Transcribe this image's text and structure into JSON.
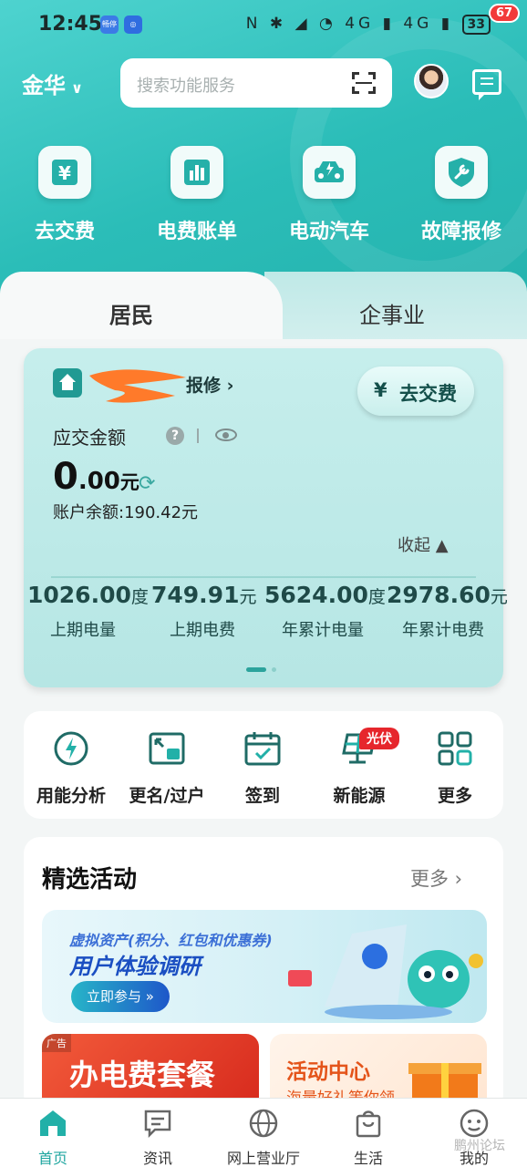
{
  "status_bar": {
    "time": "12:45",
    "app_badge_1": "畅停",
    "icons": "N ✱ ◢ ◔ 4G ▮ 4G ▮",
    "battery": "33"
  },
  "header": {
    "city": "金华",
    "search_placeholder": "搜索功能服务",
    "message_count": "67"
  },
  "quick_actions": [
    {
      "label": "去交费",
      "icon": "yuan-icon"
    },
    {
      "label": "电费账单",
      "icon": "bar-chart-icon"
    },
    {
      "label": "电动汽车",
      "icon": "ev-car-icon"
    },
    {
      "label": "故障报修",
      "icon": "repair-shield-icon"
    }
  ],
  "tabs": {
    "resident": "居民",
    "enterprise": "企事业",
    "active": "居民"
  },
  "account_card": {
    "repair_link": "报修 ›",
    "pay_button": "去交费",
    "due_label": "应交金额",
    "amount_integer": "0",
    "amount_decimal": ".00",
    "amount_unit": "元",
    "balance": "账户余额:190.42元",
    "collapse": "收起 ▲",
    "stats": [
      {
        "value": "1026.00",
        "unit": "度",
        "label": "上期电量"
      },
      {
        "value": "749.91",
        "unit": "元",
        "label": "上期电费"
      },
      {
        "value": "5624.00",
        "unit": "度",
        "label": "年累计电量"
      },
      {
        "value": "2978.60",
        "unit": "元",
        "label": "年累计电费"
      }
    ]
  },
  "services": [
    {
      "label": "用能分析",
      "icon": "energy-analysis-icon"
    },
    {
      "label": "更名/过户",
      "icon": "transfer-icon"
    },
    {
      "label": "签到",
      "icon": "calendar-check-icon"
    },
    {
      "label": "新能源",
      "icon": "solar-panel-icon",
      "badge": "光伏"
    },
    {
      "label": "更多",
      "icon": "grid-icon"
    }
  ],
  "activities": {
    "title": "精选活动",
    "more": "更多 ›",
    "banner": {
      "line1": "虚拟资产(积分、红包和优惠券)",
      "line2": "用户体验调研",
      "button": "立即参与 »"
    },
    "ad_left": {
      "tag": "广告",
      "title": "办电费套餐"
    },
    "ad_right": {
      "title": "活动中心",
      "subtitle": "海量好礼等你领"
    }
  },
  "bottom_nav": [
    {
      "label": "首页",
      "icon": "home-icon",
      "active": true
    },
    {
      "label": "资讯",
      "icon": "news-icon",
      "active": false
    },
    {
      "label": "网上营业厅",
      "icon": "globe-icon",
      "active": false
    },
    {
      "label": "生活",
      "icon": "shopping-bag-icon",
      "active": false
    },
    {
      "label": "我的",
      "icon": "profile-icon",
      "active": false
    }
  ],
  "watermark": "鹏州论坛",
  "colors": {
    "brand_teal": "#2bbdb8",
    "accent_dark": "#219a93",
    "badge_red": "#f23a3a"
  }
}
